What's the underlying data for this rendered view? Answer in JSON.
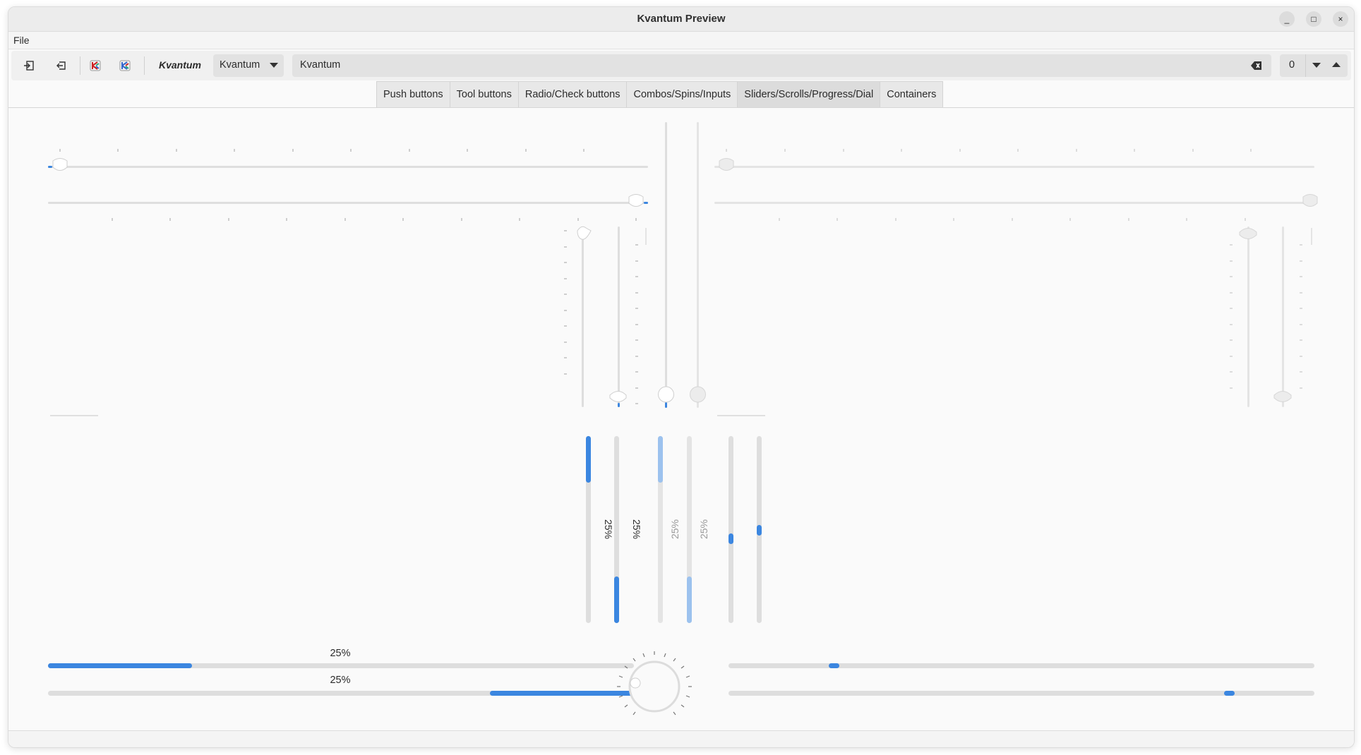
{
  "window": {
    "title": "Kvantum Preview",
    "controls": {
      "minimize": "_",
      "maximize": "□",
      "close": "×"
    }
  },
  "menubar": {
    "items": [
      {
        "label": "File"
      }
    ]
  },
  "toolbar": {
    "style_label": "Kvantum",
    "combo_value": "Kvantum",
    "line_edit_value": "Kvantum",
    "spin_value": "0",
    "icons": [
      "import-icon",
      "export-icon",
      "kvantum-logo-icon",
      "kvantum-logo-icon",
      "clear-icon",
      "chevron-down-icon",
      "chevron-up-icon"
    ]
  },
  "tabs": [
    {
      "label": "Push buttons"
    },
    {
      "label": "Tool buttons"
    },
    {
      "label": "Radio/Check buttons"
    },
    {
      "label": "Combos/Spins/Inputs"
    },
    {
      "label": "Sliders/Scrolls/Progress/Dial",
      "active": true
    },
    {
      "label": "Containers"
    }
  ],
  "sliders": {
    "horizontal_top_left": {
      "value": 0,
      "range": [
        0,
        100
      ]
    },
    "horizontal_bottom_left": {
      "value": 100,
      "range": [
        0,
        100
      ]
    },
    "horizontal_top_right": {
      "value": 0,
      "range": [
        0,
        100
      ],
      "enabled": false
    },
    "horizontal_bottom_right": {
      "value": 100,
      "range": [
        0,
        100
      ],
      "enabled": false
    },
    "vertical_left_a": {
      "value": 100,
      "range": [
        0,
        100
      ]
    },
    "vertical_left_b": {
      "value": 0,
      "range": [
        0,
        100
      ]
    },
    "vertical_mid_a": {
      "value": 0,
      "range": [
        0,
        100
      ]
    },
    "vertical_mid_b": {
      "value": 0,
      "range": [
        0,
        100
      ],
      "enabled": false
    },
    "vertical_right_a": {
      "value": 100,
      "range": [
        0,
        100
      ],
      "enabled": false
    },
    "vertical_right_b": {
      "value": 0,
      "range": [
        0,
        100
      ],
      "enabled": false
    }
  },
  "progress": {
    "vertical": [
      {
        "value": 25,
        "label": "25%",
        "inverted": true,
        "enabled": true
      },
      {
        "value": 25,
        "label": "25%",
        "inverted": false,
        "enabled": true
      },
      {
        "value": 25,
        "label": "25%",
        "inverted": true,
        "enabled": false
      },
      {
        "value": 25,
        "label": "25%",
        "inverted": false,
        "enabled": false
      }
    ],
    "horizontal": [
      {
        "value": 25,
        "label": "25%",
        "inverted": false
      },
      {
        "value": 25,
        "label": "25%",
        "inverted": true
      }
    ]
  },
  "scrollbars": {
    "vertical": [
      {
        "position": 0.55
      },
      {
        "position": 0.5
      }
    ],
    "horizontal": [
      {
        "position": 0.18
      },
      {
        "position": 0.85
      }
    ]
  },
  "dial": {
    "value": 0
  },
  "colors": {
    "accent": "#3b86e0",
    "accent_disabled": "#9cc2ee",
    "groove": "#dedede",
    "tick": "#b0b0b0"
  }
}
